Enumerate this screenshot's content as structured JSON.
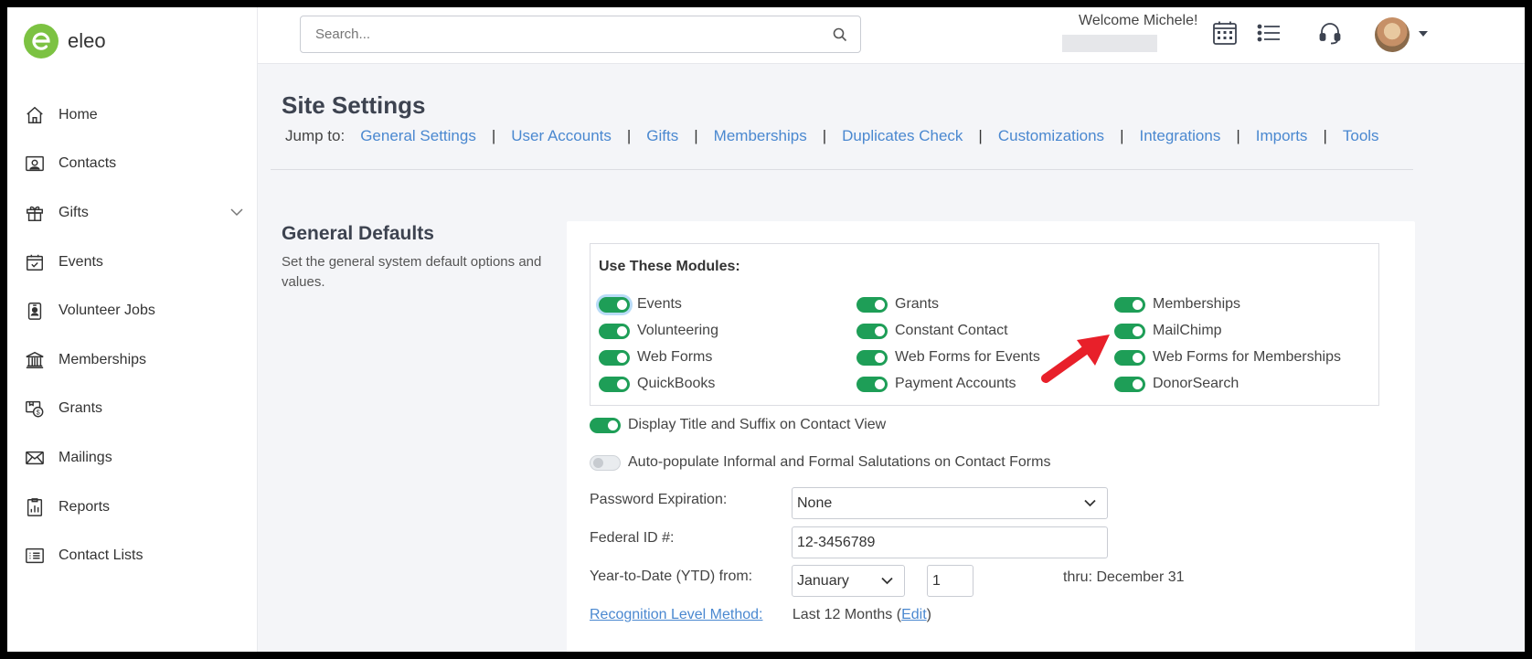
{
  "sidebar": {
    "logo_text": "eleo",
    "items": [
      {
        "label": "Home",
        "icon": "home-icon"
      },
      {
        "label": "Contacts",
        "icon": "contacts-icon"
      },
      {
        "label": "Gifts",
        "icon": "gift-icon"
      },
      {
        "label": "Events",
        "icon": "calendar-check-icon"
      },
      {
        "label": "Volunteer Jobs",
        "icon": "volunteer-badge-icon"
      },
      {
        "label": "Memberships",
        "icon": "building-icon"
      },
      {
        "label": "Grants",
        "icon": "grants-icon"
      },
      {
        "label": "Mailings",
        "icon": "envelope-icon"
      },
      {
        "label": "Reports",
        "icon": "report-chart-icon"
      },
      {
        "label": "Contact Lists",
        "icon": "list-icon"
      }
    ]
  },
  "header": {
    "search_placeholder": "Search...",
    "welcome": "Welcome Michele!"
  },
  "page": {
    "title": "Site Settings",
    "jump_label": "Jump to:",
    "jump_links": [
      "General Settings",
      "User Accounts",
      "Gifts",
      "Memberships",
      "Duplicates Check",
      "Customizations",
      "Integrations",
      "Imports",
      "Tools"
    ]
  },
  "general_defaults": {
    "title": "General Defaults",
    "description": "Set the general system default options and values.",
    "modules_title": "Use These Modules:",
    "modules": [
      {
        "label": "Events",
        "on": true
      },
      {
        "label": "Grants",
        "on": true
      },
      {
        "label": "Memberships",
        "on": true
      },
      {
        "label": "Volunteering",
        "on": true
      },
      {
        "label": "Constant Contact",
        "on": true
      },
      {
        "label": "MailChimp",
        "on": true
      },
      {
        "label": "Web Forms",
        "on": true
      },
      {
        "label": "Web Forms for Events",
        "on": true
      },
      {
        "label": "Web Forms for Memberships",
        "on": true
      },
      {
        "label": "QuickBooks",
        "on": true
      },
      {
        "label": "Payment Accounts",
        "on": true
      },
      {
        "label": "DonorSearch",
        "on": true
      }
    ],
    "display_title_suffix": {
      "label": "Display Title and Suffix on Contact View",
      "on": true
    },
    "auto_populate": {
      "label": "Auto-populate Informal and Formal Salutations on Contact Forms",
      "on": false
    },
    "password_expiration": {
      "label": "Password Expiration:",
      "value": "None"
    },
    "federal_id": {
      "label": "Federal ID #:",
      "value": "12-3456789"
    },
    "ytd": {
      "label": "Year-to-Date (YTD) from:",
      "month": "January",
      "day": "1",
      "thru": "thru: December 31"
    },
    "recognition": {
      "label": "Recognition Level Method:",
      "value": "Last 12 Months (",
      "edit": "Edit",
      "close": ")"
    }
  },
  "colors": {
    "accent_green": "#1e9e57",
    "link_blue": "#4a88d0",
    "brand_green": "#7cc242",
    "annotation_red": "#e8202a"
  }
}
